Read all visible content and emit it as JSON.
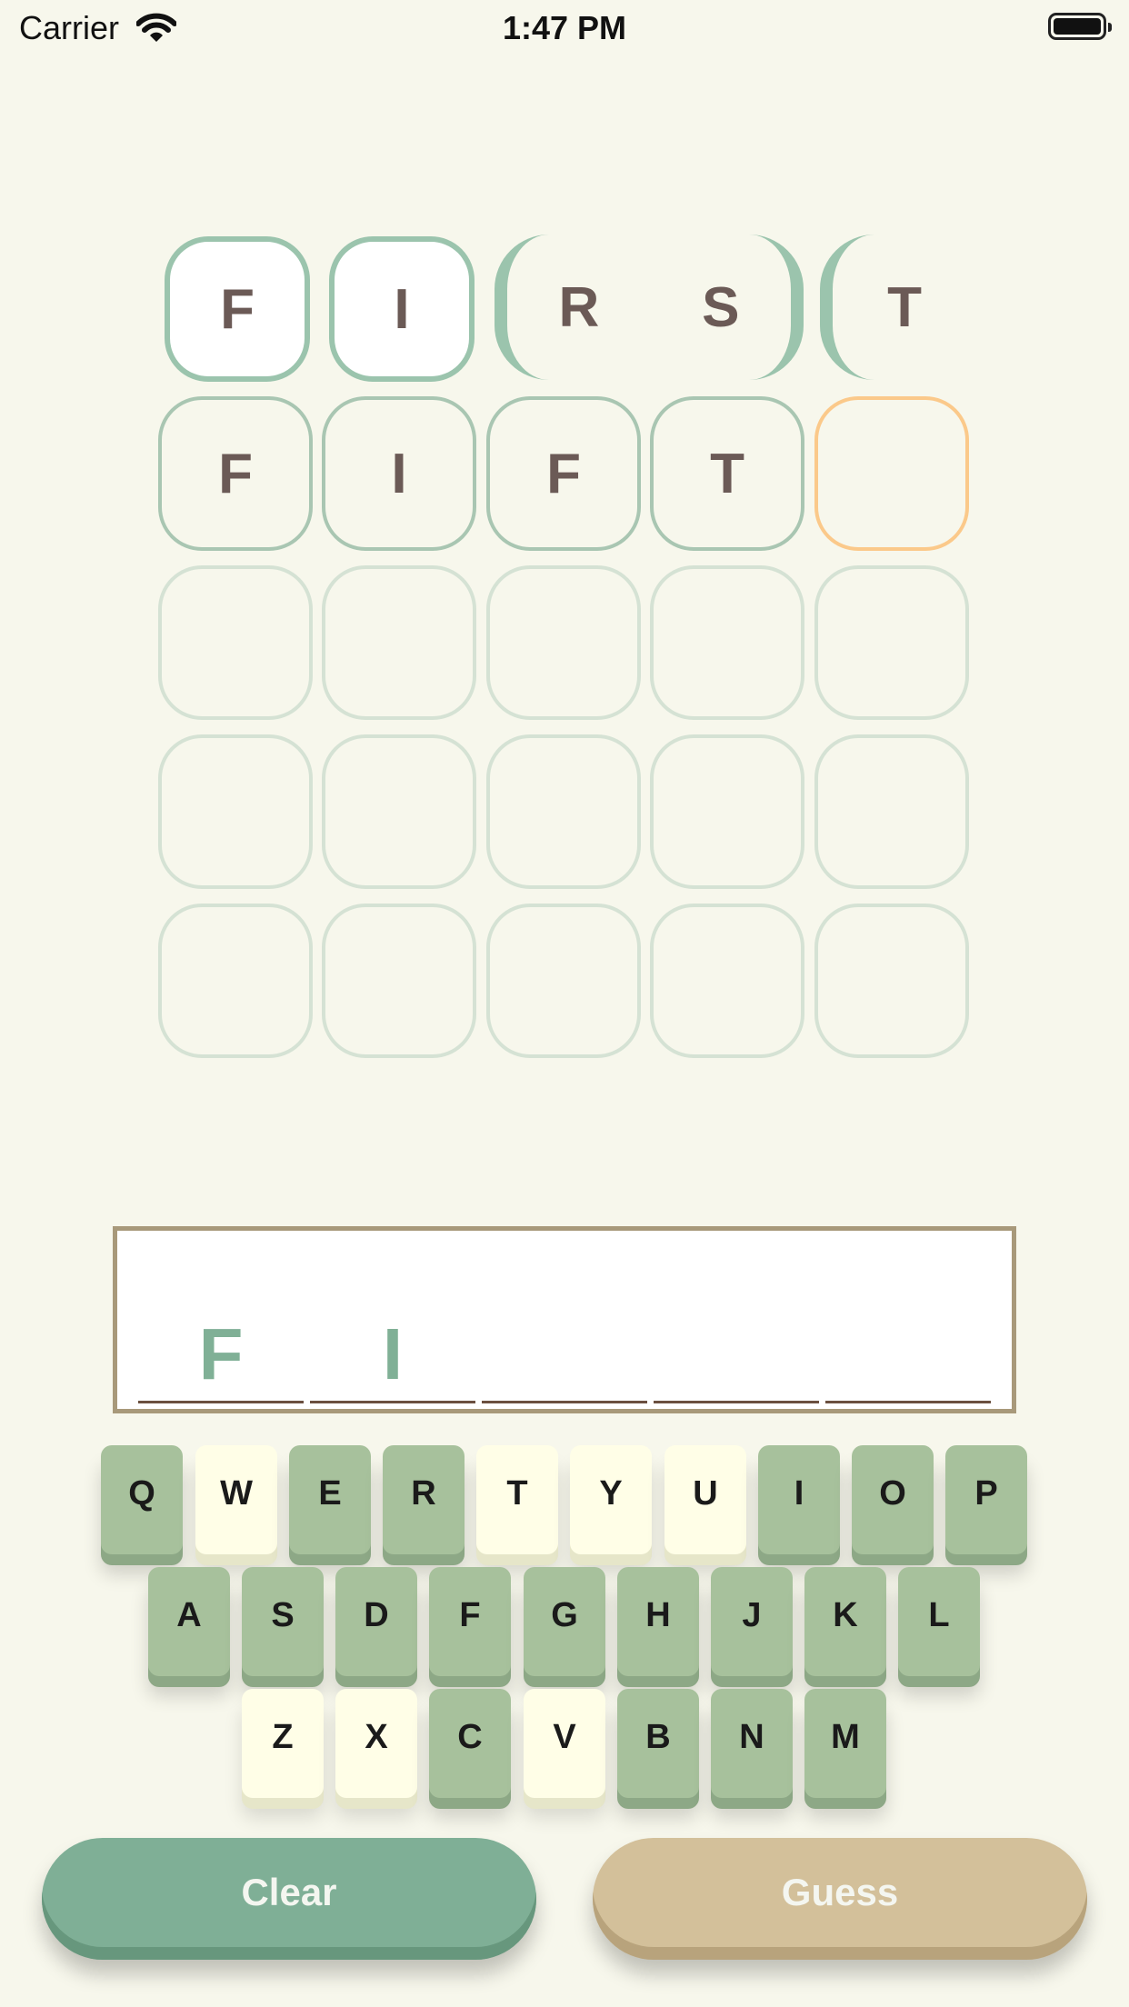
{
  "status_bar": {
    "carrier": "Carrier",
    "time": "1:47 PM"
  },
  "grid": {
    "row1": [
      "F",
      "I",
      "R",
      "S",
      "T"
    ],
    "row2": [
      "F",
      "I",
      "F",
      "T",
      ""
    ]
  },
  "entry": {
    "letters": [
      "F",
      "I",
      "",
      "",
      ""
    ]
  },
  "keyboard": {
    "row1": [
      "Q",
      "W",
      "E",
      "R",
      "T",
      "Y",
      "U",
      "I",
      "O",
      "P"
    ],
    "row2": [
      "A",
      "S",
      "D",
      "F",
      "G",
      "H",
      "J",
      "K",
      "L"
    ],
    "row3": [
      "Z",
      "X",
      "C",
      "V",
      "B",
      "N",
      "M"
    ],
    "light_keys": [
      "W",
      "T",
      "Y",
      "U",
      "Z",
      "X",
      "V"
    ]
  },
  "buttons": {
    "clear": "Clear",
    "guess": "Guess"
  },
  "colors": {
    "background": "#f7f7ec",
    "accent_green": "#7faf96",
    "accent_tan": "#d3c09a",
    "active_border": "#fbc98a"
  }
}
